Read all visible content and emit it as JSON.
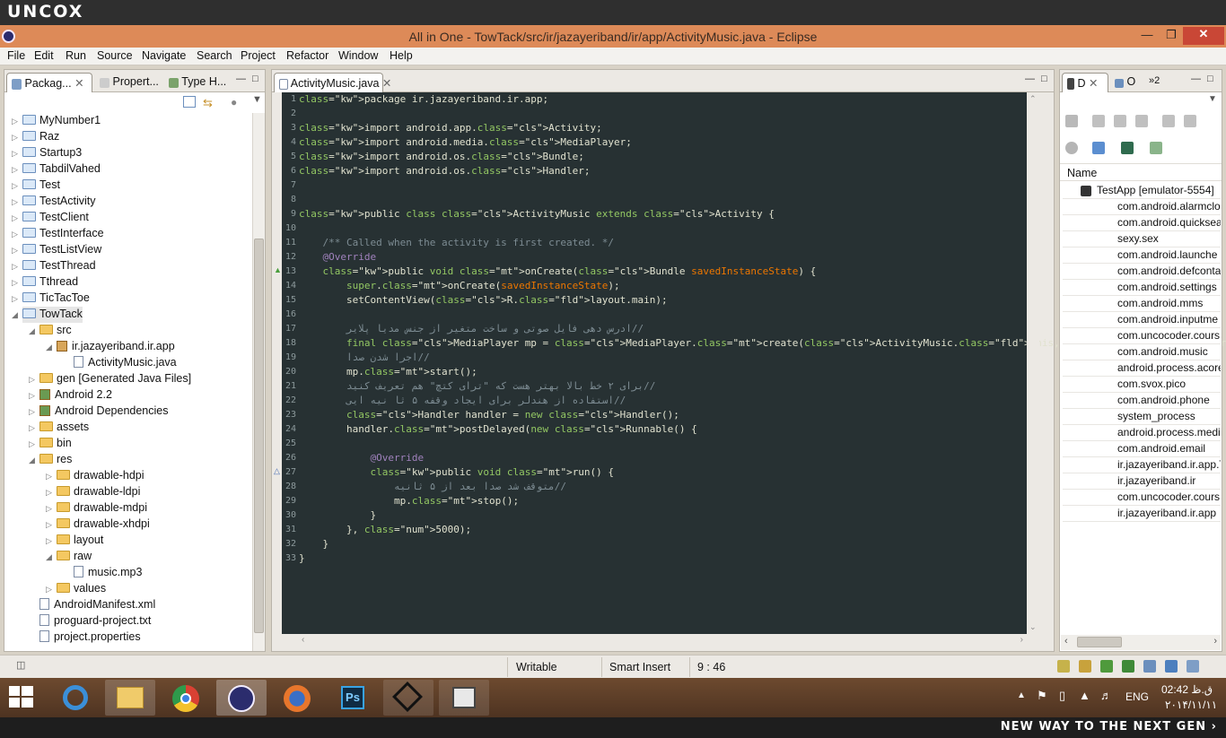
{
  "brand": "UNCOX",
  "window": {
    "title": "All in One - TowTack/src/ir/jazayeriband/ir/app/ActivityMusic.java - Eclipse"
  },
  "menu": [
    "File",
    "Edit",
    "Run",
    "Source",
    "Navigate",
    "Search",
    "Project",
    "Refactor",
    "Window",
    "Help"
  ],
  "left_tabs": [
    "Packag...",
    "Propert...",
    "Type H..."
  ],
  "tree": [
    {
      "label": "MyNumber1",
      "indent": 0,
      "icon": "project"
    },
    {
      "label": "Raz",
      "indent": 0,
      "icon": "project"
    },
    {
      "label": "Startup3",
      "indent": 0,
      "icon": "project"
    },
    {
      "label": "TabdilVahed",
      "indent": 0,
      "icon": "project"
    },
    {
      "label": "Test",
      "indent": 0,
      "icon": "project"
    },
    {
      "label": "TestActivity",
      "indent": 0,
      "icon": "project"
    },
    {
      "label": "TestClient",
      "indent": 0,
      "icon": "project"
    },
    {
      "label": "TestInterface",
      "indent": 0,
      "icon": "project"
    },
    {
      "label": "TestListView",
      "indent": 0,
      "icon": "project"
    },
    {
      "label": "TestThread",
      "indent": 0,
      "icon": "project"
    },
    {
      "label": "Tthread",
      "indent": 0,
      "icon": "project"
    },
    {
      "label": "TicTacToe",
      "indent": 0,
      "icon": "project"
    },
    {
      "label": "TowTack",
      "indent": 0,
      "icon": "project-open"
    },
    {
      "label": "src",
      "indent": 1,
      "icon": "folder"
    },
    {
      "label": "ir.jazayeriband.ir.app",
      "indent": 2,
      "icon": "package"
    },
    {
      "label": "ActivityMusic.java",
      "indent": 3,
      "icon": "file"
    },
    {
      "label": "gen [Generated Java Files]",
      "indent": 1,
      "icon": "folder"
    },
    {
      "label": "Android 2.2",
      "indent": 1,
      "icon": "library"
    },
    {
      "label": "Android Dependencies",
      "indent": 1,
      "icon": "library"
    },
    {
      "label": "assets",
      "indent": 1,
      "icon": "folder"
    },
    {
      "label": "bin",
      "indent": 1,
      "icon": "folder"
    },
    {
      "label": "res",
      "indent": 1,
      "icon": "folder"
    },
    {
      "label": "drawable-hdpi",
      "indent": 2,
      "icon": "folder"
    },
    {
      "label": "drawable-ldpi",
      "indent": 2,
      "icon": "folder"
    },
    {
      "label": "drawable-mdpi",
      "indent": 2,
      "icon": "folder"
    },
    {
      "label": "drawable-xhdpi",
      "indent": 2,
      "icon": "folder"
    },
    {
      "label": "layout",
      "indent": 2,
      "icon": "folder"
    },
    {
      "label": "raw",
      "indent": 2,
      "icon": "folder"
    },
    {
      "label": "music.mp3",
      "indent": 3,
      "icon": "file"
    },
    {
      "label": "values",
      "indent": 2,
      "icon": "folder"
    },
    {
      "label": "AndroidManifest.xml",
      "indent": 1,
      "icon": "file"
    },
    {
      "label": "proguard-project.txt",
      "indent": 1,
      "icon": "file"
    },
    {
      "label": "project.properties",
      "indent": 1,
      "icon": "file"
    }
  ],
  "editor": {
    "tab": "ActivityMusic.java",
    "lines": [
      "package ir.jazayeriband.ir.app;",
      "",
      "import android.app.Activity;",
      "import android.media.MediaPlayer;",
      "import android.os.Bundle;",
      "import android.os.Handler;",
      "",
      "",
      "public class ActivityMusic extends Activity {",
      "",
      "    /** Called when the activity is first created. */",
      "    @Override",
      "    public void onCreate(Bundle savedInstanceState) {",
      "        super.onCreate(savedInstanceState);",
      "        setContentView(R.layout.main);",
      "",
      "        //ادرس دهی فایل صوتی و ساخت متغیر از جنس مدیا پلایر",
      "        final MediaPlayer mp = MediaPlayer.create(ActivityMusic.this, R.raw.music);",
      "        //اجرا شدن صدا",
      "        mp.start();",
      "        //برای ۲ خط بالا بهتر هست که \"ترای کتچ\" هم تعریف کنید",
      "        //استفاده از هندلر برای ایجاد وقفه ۵ ثا نیه ایی",
      "        Handler handler = new Handler();",
      "        handler.postDelayed(new Runnable() {",
      "",
      "            @Override",
      "            public void run() {",
      "                //متوقف شد صدا بعد از ۵ ثانیه",
      "                mp.stop();",
      "            }",
      "        }, 5000);",
      "    }",
      "}"
    ]
  },
  "right_tabs": [
    "D",
    "O",
    "»2"
  ],
  "devices": {
    "header": "Name",
    "items": [
      "TestApp [emulator-5554]",
      "com.android.alarmclo",
      "com.android.quicksea",
      "sexy.sex",
      "com.android.launche",
      "com.android.defconta",
      "com.android.settings",
      "com.android.mms",
      "com.android.inputme",
      "com.uncocoder.cours",
      "com.android.music",
      "android.process.acore",
      "com.svox.pico",
      "com.android.phone",
      "system_process",
      "android.process.medi",
      "com.android.email",
      "ir.jazayeriband.ir.app.T",
      "ir.jazayeriband.ir",
      "com.uncocoder.cours",
      "ir.jazayeriband.ir.app"
    ]
  },
  "status": {
    "writable": "Writable",
    "insert": "Smart Insert",
    "position": "9 : 46"
  },
  "tray": {
    "lang": "ENG",
    "time": "02:42 ق.ظ",
    "date": "۲۰۱۴/۱۱/۱۱"
  },
  "footer": "NEW WAY TO THE NEXT GEN ›"
}
